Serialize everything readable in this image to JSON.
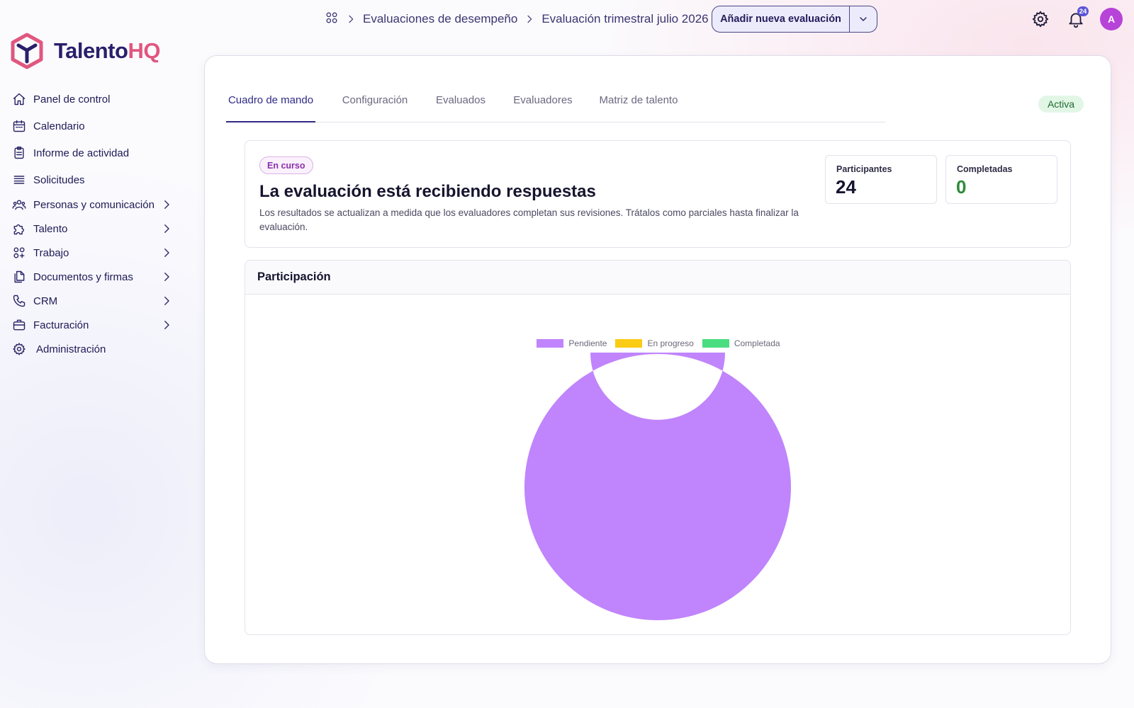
{
  "brand": {
    "name_part1": "Talento",
    "name_part2": "HQ",
    "primary_color": "#2a1f6b",
    "accent_color": "#e0577f"
  },
  "sidebar": {
    "items": [
      {
        "label": "Panel de control",
        "icon": "home-icon",
        "has_submenu": false
      },
      {
        "label": "Calendario",
        "icon": "calendar-icon",
        "has_submenu": false
      },
      {
        "label": "Informe de actividad",
        "icon": "clipboard-icon",
        "has_submenu": false
      },
      {
        "label": "Solicitudes",
        "icon": "list-icon",
        "has_submenu": false
      },
      {
        "label": "Personas y comunicación",
        "icon": "users-icon",
        "has_submenu": true
      },
      {
        "label": "Talento",
        "icon": "puzzle-icon",
        "has_submenu": true
      },
      {
        "label": "Trabajo",
        "icon": "apps-icon",
        "has_submenu": true
      },
      {
        "label": "Documentos y firmas",
        "icon": "documents-icon",
        "has_submenu": true
      },
      {
        "label": "CRM",
        "icon": "phone-icon",
        "has_submenu": true
      },
      {
        "label": "Facturación",
        "icon": "briefcase-icon",
        "has_submenu": true
      },
      {
        "label": "Administración",
        "icon": "gear-icon",
        "has_submenu": false
      }
    ]
  },
  "header": {
    "breadcrumbs": [
      "Evaluaciones de desempeño",
      "Evaluación trimestral julio 2026"
    ],
    "primary_action": "Añadir nueva evaluación",
    "notification_count": "24",
    "avatar_initial": "A"
  },
  "tabs": [
    {
      "label": "Cuadro de mando",
      "active": true
    },
    {
      "label": "Configuración",
      "active": false
    },
    {
      "label": "Evaluados",
      "active": false
    },
    {
      "label": "Evaluadores",
      "active": false
    },
    {
      "label": "Matriz de talento",
      "active": false
    }
  ],
  "status": "Activa",
  "summary": {
    "badge": "En curso",
    "title": "La evaluación está recibiendo respuestas",
    "description": "Los resultados se actualizan a medida que los evaluadores completan sus revisiones. Trátalos como parciales hasta finalizar la evaluación.",
    "stats": [
      {
        "label": "Participantes",
        "value": "24"
      },
      {
        "label": "Completadas",
        "value": "0"
      }
    ]
  },
  "participation": {
    "title": "Participación"
  },
  "chart_data": {
    "type": "pie",
    "variant": "doughnut",
    "categories": [
      "Pendiente",
      "En progreso",
      "Completada"
    ],
    "values": [
      24,
      0,
      0
    ],
    "colors": [
      "#c084fc",
      "#facc15",
      "#4ade80"
    ],
    "legend": "top"
  }
}
